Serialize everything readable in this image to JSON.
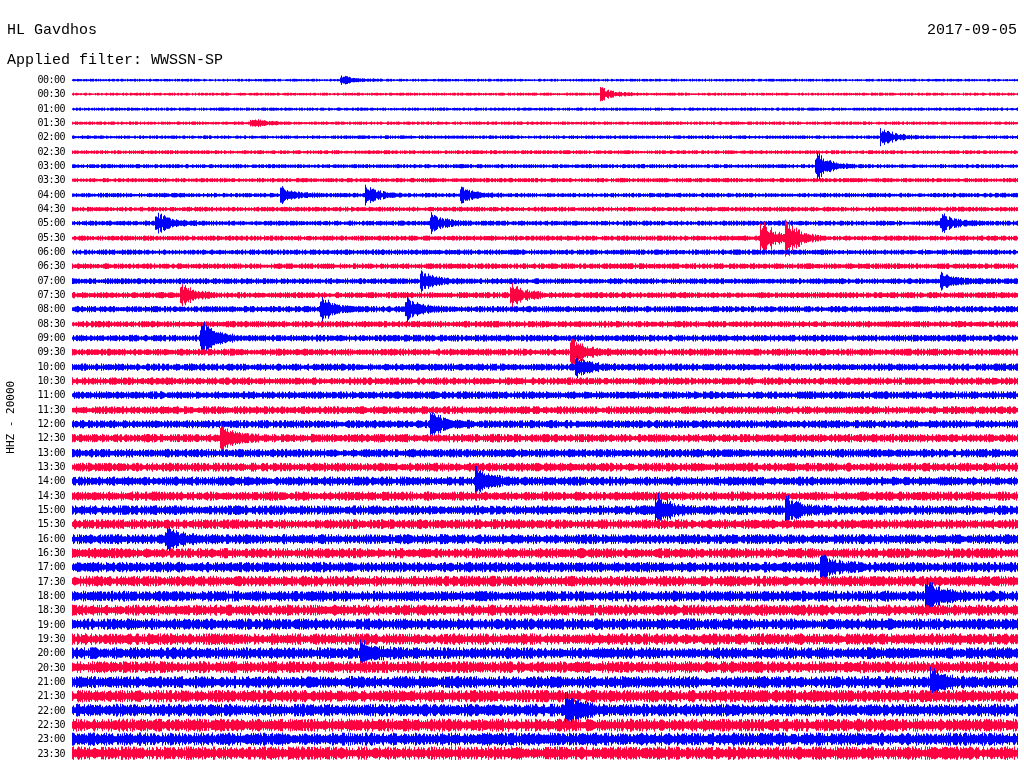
{
  "header": {
    "station": "HL Gavdhos",
    "date": "2017-09-05",
    "filter": "Applied filter: WWSSN-SP"
  },
  "channel_label": "HHZ - 20000",
  "rows": [
    {
      "time": "00:00",
      "color": "#0000ff"
    },
    {
      "time": "00:30",
      "color": "#ff0040"
    },
    {
      "time": "01:00",
      "color": "#0000ff"
    },
    {
      "time": "01:30",
      "color": "#ff0040"
    },
    {
      "time": "02:00",
      "color": "#0000ff"
    },
    {
      "time": "02:30",
      "color": "#ff0040"
    },
    {
      "time": "03:00",
      "color": "#0000ff"
    },
    {
      "time": "03:30",
      "color": "#ff0040"
    },
    {
      "time": "04:00",
      "color": "#0000ff"
    },
    {
      "time": "04:30",
      "color": "#ff0040"
    },
    {
      "time": "05:00",
      "color": "#0000ff"
    },
    {
      "time": "05:30",
      "color": "#ff0040"
    },
    {
      "time": "06:00",
      "color": "#0000ff"
    },
    {
      "time": "06:30",
      "color": "#ff0040"
    },
    {
      "time": "07:00",
      "color": "#0000ff"
    },
    {
      "time": "07:30",
      "color": "#ff0040"
    },
    {
      "time": "08:00",
      "color": "#0000ff"
    },
    {
      "time": "08:30",
      "color": "#ff0040"
    },
    {
      "time": "09:00",
      "color": "#0000ff"
    },
    {
      "time": "09:30",
      "color": "#ff0040"
    },
    {
      "time": "10:00",
      "color": "#0000ff"
    },
    {
      "time": "10:30",
      "color": "#ff0040"
    },
    {
      "time": "11:00",
      "color": "#0000ff"
    },
    {
      "time": "11:30",
      "color": "#ff0040"
    },
    {
      "time": "12:00",
      "color": "#0000ff"
    },
    {
      "time": "12:30",
      "color": "#ff0040"
    },
    {
      "time": "13:00",
      "color": "#0000ff"
    },
    {
      "time": "13:30",
      "color": "#ff0040"
    },
    {
      "time": "14:00",
      "color": "#0000ff"
    },
    {
      "time": "14:30",
      "color": "#ff0040"
    },
    {
      "time": "15:00",
      "color": "#0000ff"
    },
    {
      "time": "15:30",
      "color": "#ff0040"
    },
    {
      "time": "16:00",
      "color": "#0000ff"
    },
    {
      "time": "16:30",
      "color": "#ff0040"
    },
    {
      "time": "17:00",
      "color": "#0000ff"
    },
    {
      "time": "17:30",
      "color": "#ff0040"
    },
    {
      "time": "18:00",
      "color": "#0000ff"
    },
    {
      "time": "18:30",
      "color": "#ff0040"
    },
    {
      "time": "19:00",
      "color": "#0000ff"
    },
    {
      "time": "19:30",
      "color": "#ff0040"
    },
    {
      "time": "20:00",
      "color": "#0000ff"
    },
    {
      "time": "20:30",
      "color": "#ff0040"
    },
    {
      "time": "21:00",
      "color": "#0000ff"
    },
    {
      "time": "21:30",
      "color": "#ff0040"
    },
    {
      "time": "22:00",
      "color": "#0000ff"
    },
    {
      "time": "22:30",
      "color": "#ff0040"
    },
    {
      "time": "23:00",
      "color": "#0000ff"
    },
    {
      "time": "23:30",
      "color": "#ff0040"
    }
  ]
}
